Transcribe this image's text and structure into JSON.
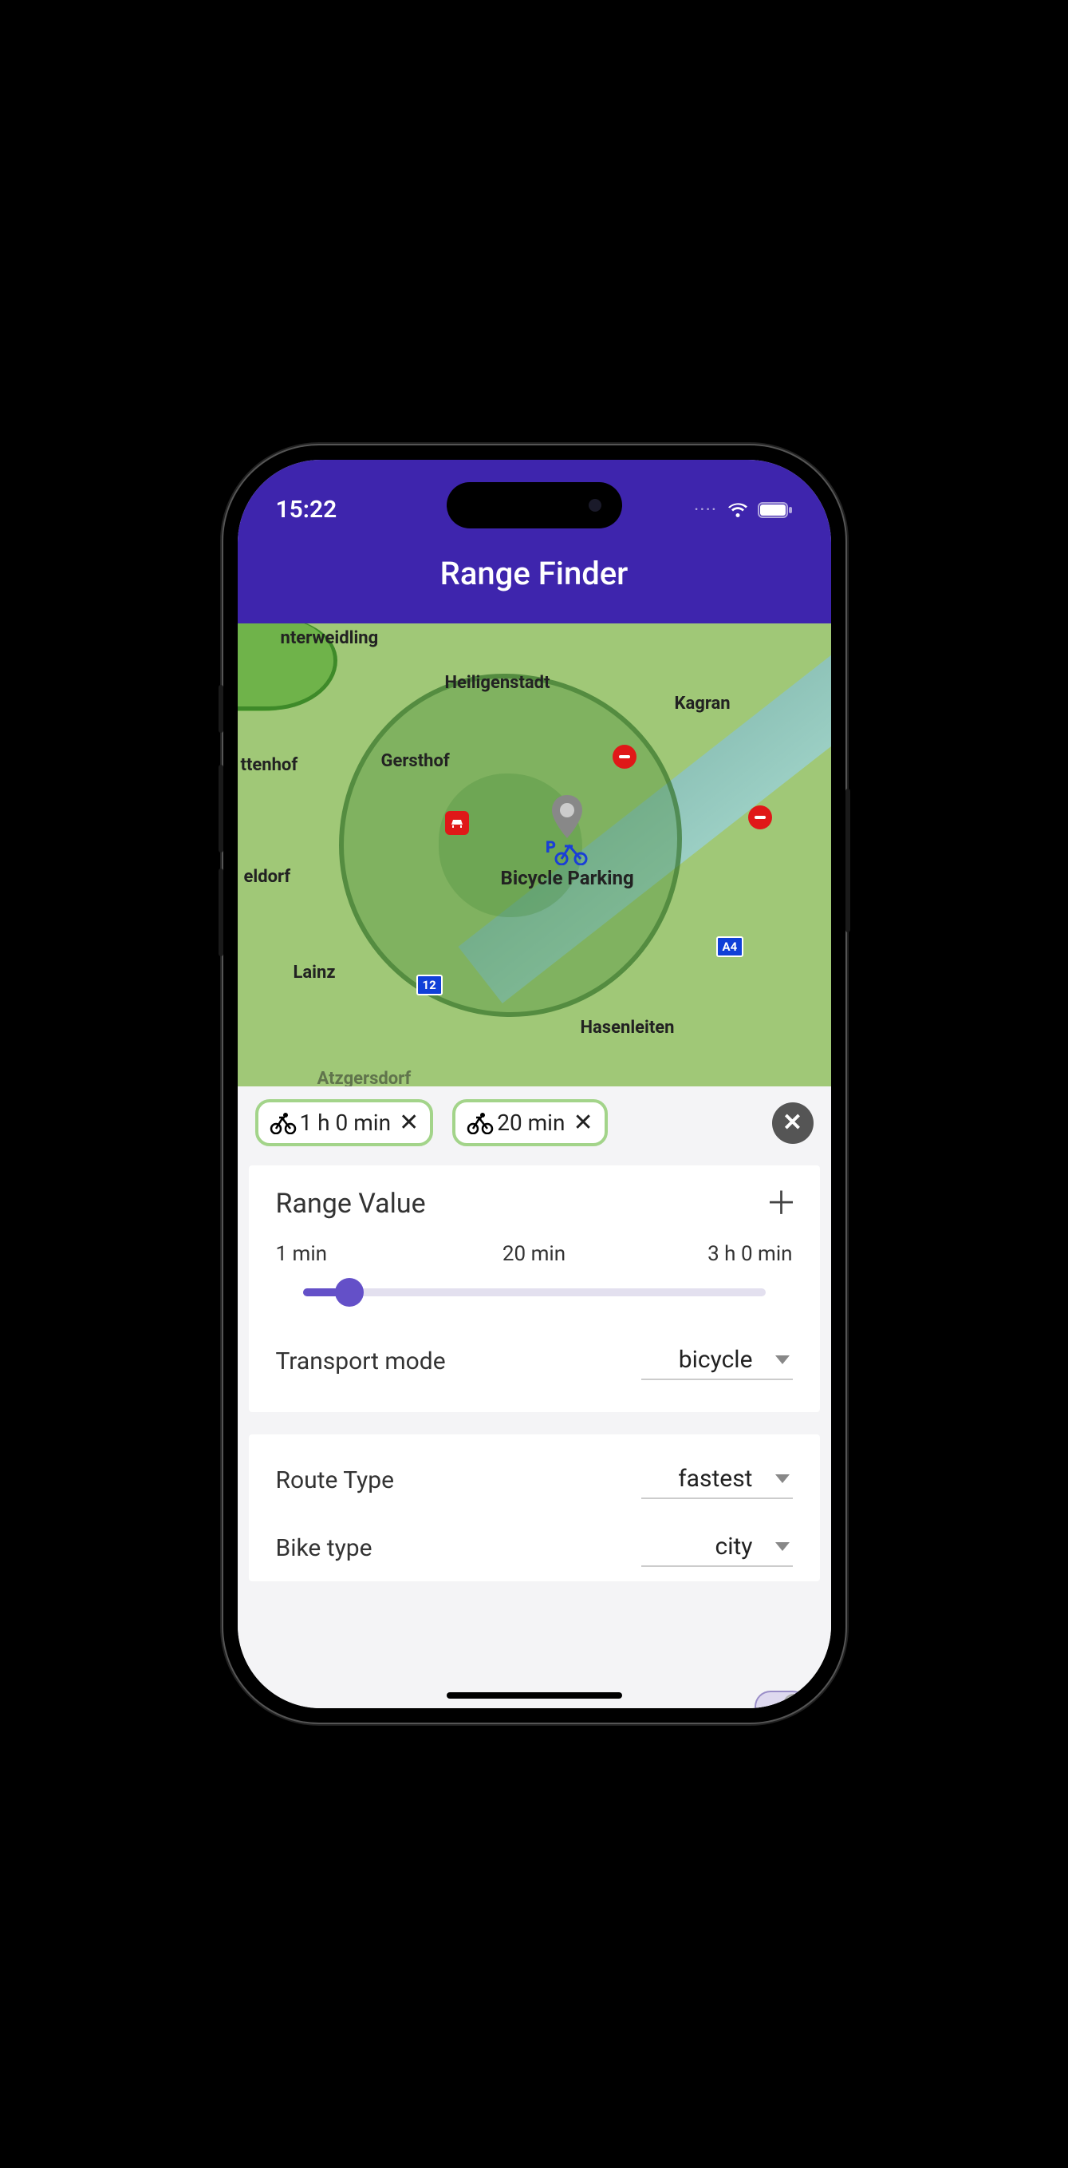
{
  "status": {
    "time": "15:22",
    "dots": "····"
  },
  "header": {
    "title": "Range Finder"
  },
  "map": {
    "labels": {
      "nterweidling": "nterweidling",
      "heiligenstadt": "Heiligenstadt",
      "kagran": "Kagran",
      "gersthof": "Gersthof",
      "ttenhof": "ttenhof",
      "eldorf": "eldorf",
      "lainz": "Lainz",
      "hasenleiten": "Hasenleiten",
      "atz": "Atzgersdorf"
    },
    "pin_label": "Bicycle Parking",
    "roads": {
      "a4": "A4",
      "r12": "12"
    }
  },
  "chips": [
    {
      "label": "1 h 0 min"
    },
    {
      "label": "20 min"
    }
  ],
  "range": {
    "title": "Range Value",
    "min_label": "1 min",
    "value_label": "20 min",
    "max_label": "3 h 0 min"
  },
  "transport": {
    "label": "Transport mode",
    "value": "bicycle"
  },
  "route_type": {
    "label": "Route Type",
    "value": "fastest"
  },
  "bike_type": {
    "label": "Bike type",
    "value": "city"
  }
}
